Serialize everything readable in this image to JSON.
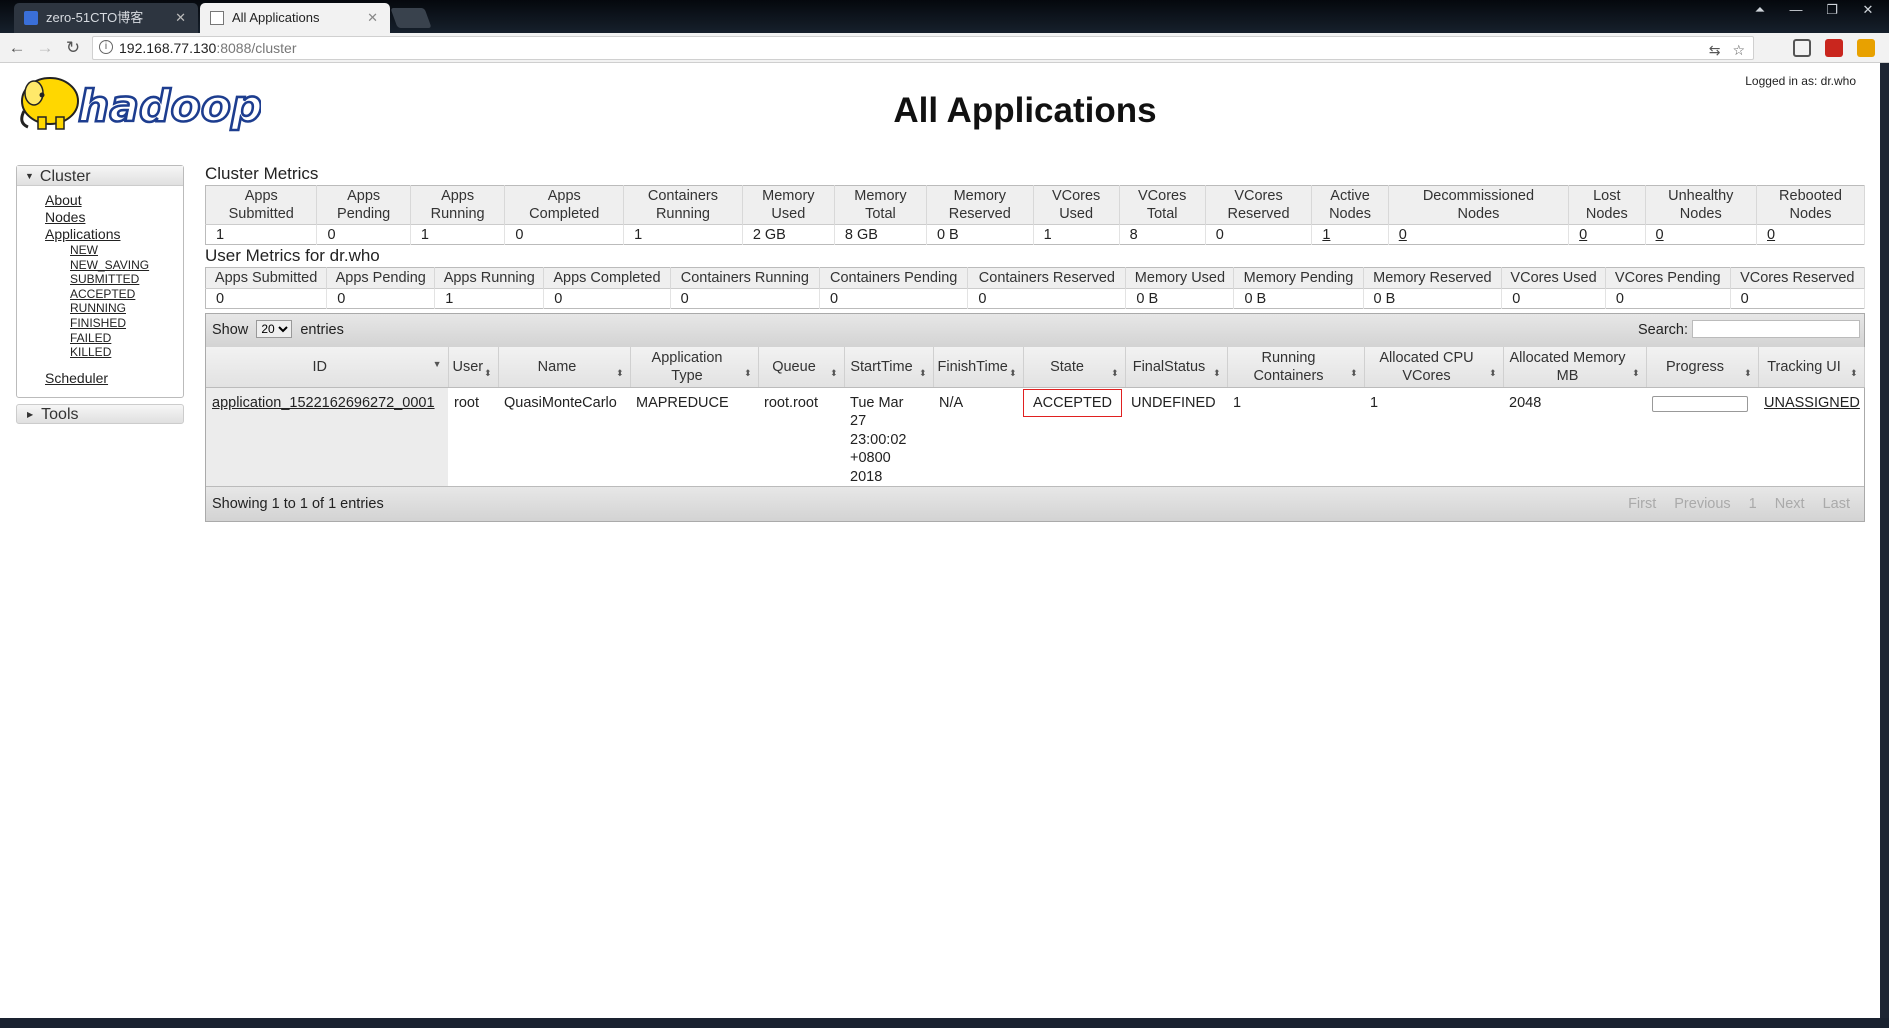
{
  "browser": {
    "tabs": [
      {
        "title": "zero-51CTO博客",
        "active": false
      },
      {
        "title": "All Applications",
        "active": true
      }
    ],
    "url_host": "192.168.77.130",
    "url_path": ":8088/cluster"
  },
  "header": {
    "title": "All Applications",
    "logged_in": "Logged in as: dr.who",
    "logo_text": "hadoop"
  },
  "sidebar": {
    "cluster_label": "Cluster",
    "links": [
      "About",
      "Nodes",
      "Applications"
    ],
    "app_states": [
      "NEW",
      "NEW_SAVING",
      "SUBMITTED",
      "ACCEPTED",
      "RUNNING",
      "FINISHED",
      "FAILED",
      "KILLED"
    ],
    "scheduler": "Scheduler",
    "tools_label": "Tools"
  },
  "cluster_metrics": {
    "title": "Cluster Metrics",
    "headers": [
      [
        "Apps",
        "Submitted"
      ],
      [
        "Apps",
        "Pending"
      ],
      [
        "Apps",
        "Running"
      ],
      [
        "Apps",
        "Completed"
      ],
      [
        "Containers",
        "Running"
      ],
      [
        "Memory",
        "Used"
      ],
      [
        "Memory",
        "Total"
      ],
      [
        "Memory",
        "Reserved"
      ],
      [
        "VCores",
        "Used"
      ],
      [
        "VCores",
        "Total"
      ],
      [
        "VCores",
        "Reserved"
      ],
      [
        "Active",
        "Nodes"
      ],
      [
        "Decommissioned",
        "Nodes"
      ],
      [
        "Lost",
        "Nodes"
      ],
      [
        "Unhealthy",
        "Nodes"
      ],
      [
        "Rebooted",
        "Nodes"
      ]
    ],
    "values": [
      "1",
      "0",
      "1",
      "0",
      "1",
      "2 GB",
      "8 GB",
      "0 B",
      "1",
      "8",
      "0",
      "1",
      "0",
      "0",
      "0",
      "0"
    ]
  },
  "user_metrics": {
    "title": "User Metrics for dr.who",
    "headers": [
      "Apps Submitted",
      "Apps Pending",
      "Apps Running",
      "Apps Completed",
      "Containers Running",
      "Containers Pending",
      "Containers Reserved",
      "Memory Used",
      "Memory Pending",
      "Memory Reserved",
      "VCores Used",
      "VCores Pending",
      "VCores Reserved"
    ],
    "values": [
      "0",
      "0",
      "1",
      "0",
      "0",
      "0",
      "0",
      "0 B",
      "0 B",
      "0 B",
      "0",
      "0",
      "0"
    ]
  },
  "apps_table": {
    "show_label": "Show",
    "page_size": "20",
    "entries_label": "entries",
    "search_label": "Search:",
    "columns": [
      [
        "ID"
      ],
      [
        "User"
      ],
      [
        "Name"
      ],
      [
        "Application Type"
      ],
      [
        "Queue"
      ],
      [
        "StartTime"
      ],
      [
        "FinishTime"
      ],
      [
        "State"
      ],
      [
        "FinalStatus"
      ],
      [
        "Running",
        "Containers"
      ],
      [
        "Allocated CPU",
        "VCores"
      ],
      [
        "Allocated Memory",
        "MB"
      ],
      [
        "Progress"
      ],
      [
        "Tracking UI"
      ]
    ],
    "rows": [
      {
        "id": "application_1522162696272_0001",
        "user": "root",
        "name": "QuasiMonteCarlo",
        "type": "MAPREDUCE",
        "queue": "root.root",
        "start_time": [
          "Tue Mar",
          "27",
          "23:00:02",
          "+0800",
          "2018"
        ],
        "finish_time": "N/A",
        "state": "ACCEPTED",
        "final_status": "UNDEFINED",
        "running_containers": "1",
        "alloc_vcores": "1",
        "alloc_memory": "2048",
        "progress": 0,
        "tracking_ui": "UNASSIGNED"
      }
    ],
    "footer": "Showing 1 to 1 of 1 entries",
    "pager": [
      "First",
      "Previous",
      "1",
      "Next",
      "Last"
    ]
  }
}
